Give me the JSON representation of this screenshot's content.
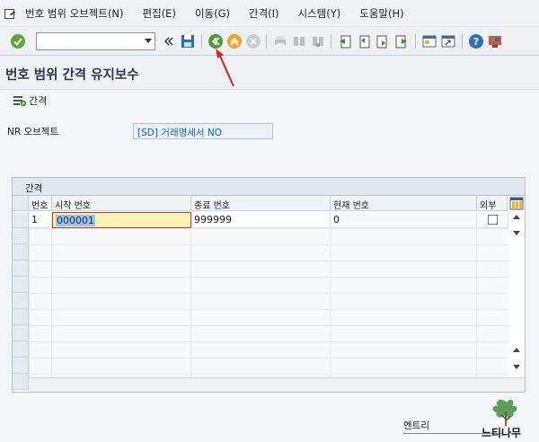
{
  "menu": {
    "items": [
      "번호 범위 오브젝트(N)",
      "편집(E)",
      "이동(G)",
      "간격(I)",
      "시스템(Y)",
      "도움말(H)"
    ]
  },
  "toolbar": {
    "command_value": "",
    "icons": [
      "check-icon",
      "back-icon",
      "save-icon",
      "green-back-icon",
      "exit-icon",
      "cancel-icon",
      "print-icon",
      "find-icon",
      "find-next-icon",
      "first-page-icon",
      "prev-page-icon",
      "next-page-icon",
      "last-page-icon",
      "new-session-icon",
      "shortcut-icon",
      "help-icon",
      "customize-icon"
    ]
  },
  "title": "번호 범위 간격 유지보수",
  "sub_toolbar": {
    "interval_label": "간격"
  },
  "nr_object": {
    "label": "NR 오브젝트",
    "value": "[SD] 거래명세서 NO"
  },
  "table": {
    "title": "간격",
    "headers": [
      "번호",
      "시작 번호",
      "종료 번호",
      "현재 번호",
      "외부"
    ],
    "rows": [
      {
        "no": "1",
        "start": "000001",
        "end": "999999",
        "current": "0",
        "external": false
      }
    ]
  },
  "footer": {
    "entry_label": "엔트리"
  },
  "watermark": {
    "text": "느티나무"
  },
  "colors": {
    "accent_blue": "#1c64a8",
    "highlight_yellow": "#fff2b3",
    "arrow_red": "#e02020"
  }
}
